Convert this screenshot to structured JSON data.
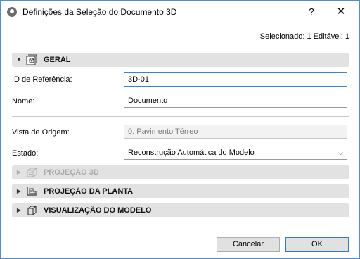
{
  "window": {
    "title": "Definições da Seleção do Documento 3D",
    "help_label": "?",
    "close_label": "✕"
  },
  "selection_info": "Selecionado: 1 Editável: 1",
  "sections": {
    "geral": {
      "label": "GERAL",
      "expanded": true,
      "icon": "document-3d-icon"
    },
    "projecao_3d": {
      "label": "PROJEÇÃO 3D",
      "expanded": false,
      "disabled": true,
      "icon": "3d-box-icon"
    },
    "projecao_planta": {
      "label": "PROJEÇÃO DA PLANTA",
      "expanded": false,
      "icon": "floor-plan-icon"
    },
    "visualizacao_modelo": {
      "label": "VISUALIZAÇÃO DO MODELO",
      "expanded": false,
      "icon": "model-cube-icon"
    }
  },
  "fields": {
    "reference_id": {
      "label": "ID de Referência:",
      "value": "3D-01"
    },
    "name": {
      "label": "Nome:",
      "value": "Documento"
    },
    "source_view": {
      "label": "Vista de Origem:",
      "value": "0. Pavimento Térreo"
    },
    "state": {
      "label": "Estado:",
      "value": "Reconstrução Automática do Modelo"
    }
  },
  "buttons": {
    "cancel": "Cancelar",
    "ok": "OK"
  },
  "colors": {
    "accent": "#3a86c8",
    "section_bar": "#e2e2e2",
    "window_border": "#4f8fcf"
  }
}
